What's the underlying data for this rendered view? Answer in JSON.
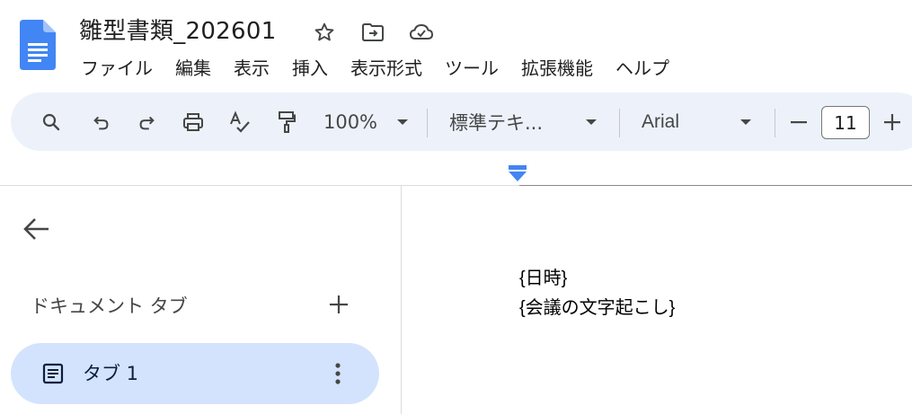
{
  "document": {
    "title": "雛型書類_202601"
  },
  "menu": {
    "items": [
      "ファイル",
      "編集",
      "表示",
      "挿入",
      "表示形式",
      "ツール",
      "拡張機能",
      "ヘルプ"
    ]
  },
  "toolbar": {
    "zoom": "100%",
    "style": "標準テキ...",
    "font": "Arial",
    "font_size": "11"
  },
  "sidebar": {
    "section_label": "ドキュメント タブ",
    "tabs": [
      {
        "label": "タブ 1"
      }
    ]
  },
  "body": {
    "lines": [
      "{日時}",
      "{会議の文字起こし}"
    ]
  },
  "colors": {
    "docs_blue": "#4285f4",
    "toolbar_bg": "#edf2fa",
    "tab_selected_bg": "#d3e3fd"
  }
}
